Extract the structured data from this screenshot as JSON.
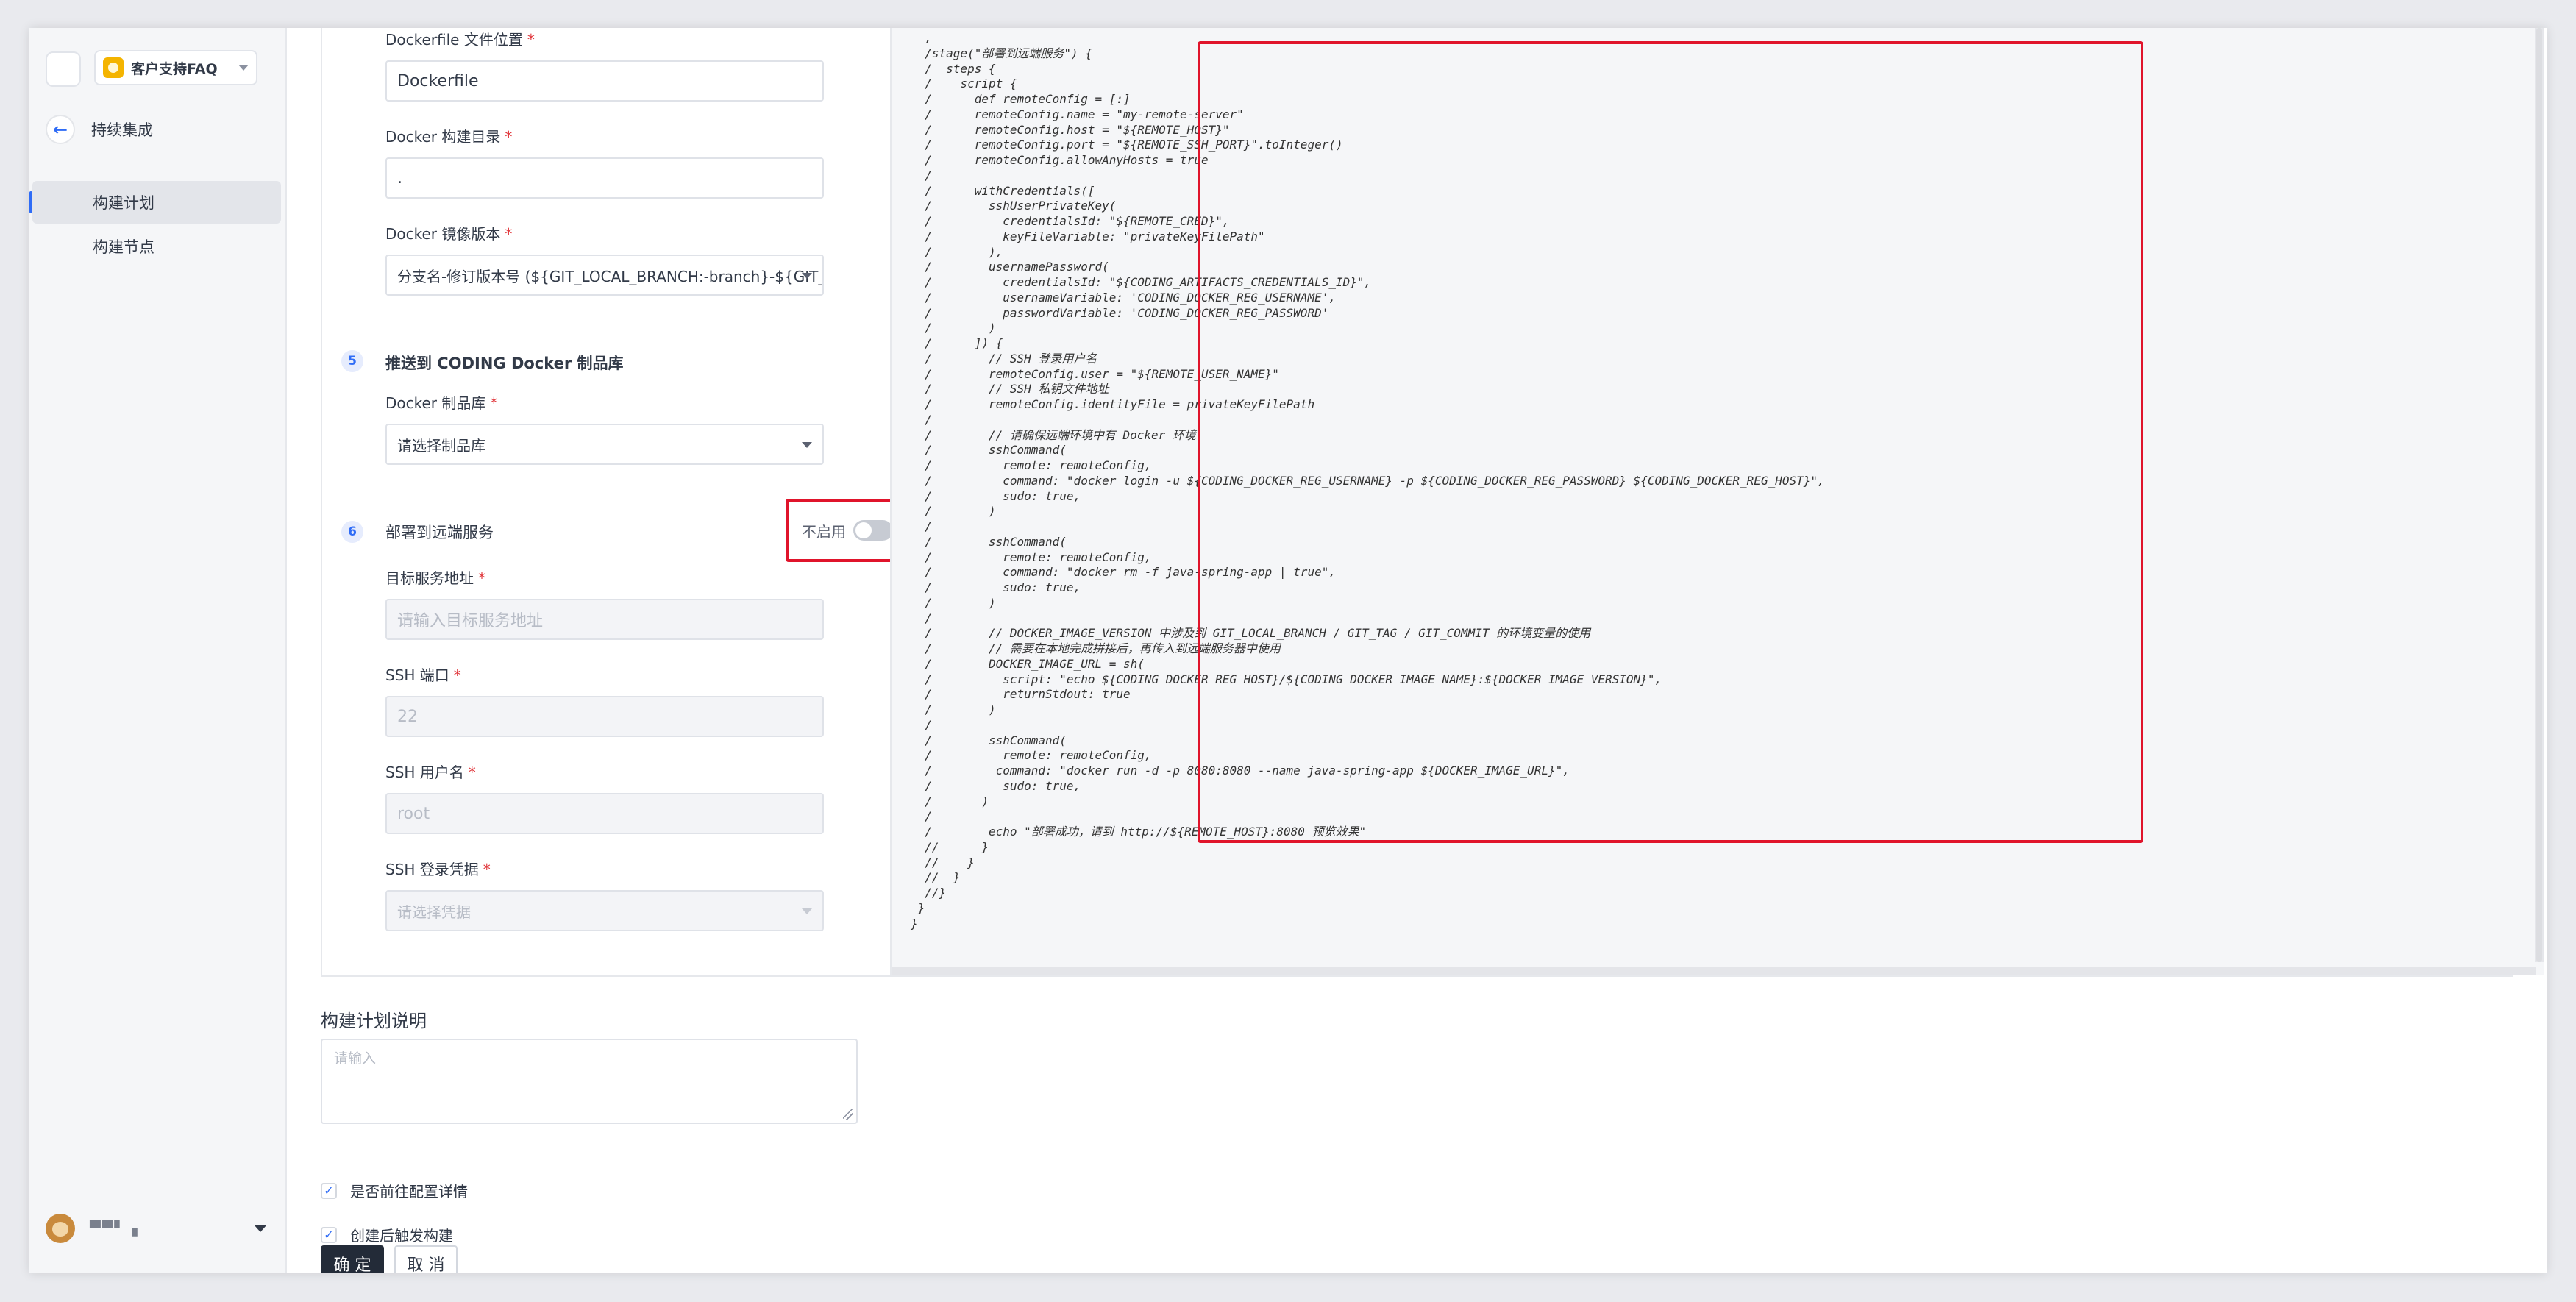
{
  "sidebar": {
    "project_name": "客户支持FAQ",
    "back_label": "持续集成",
    "items": [
      {
        "label": "构建计划",
        "active": true
      },
      {
        "label": "构建节点",
        "active": false
      }
    ],
    "user_name": "▀▀▘▗"
  },
  "form": {
    "dockerfile_label": "Dockerfile 文件位置",
    "dockerfile_value": "Dockerfile",
    "build_dir_label": "Docker 构建目录",
    "build_dir_value": ".",
    "image_version_label": "Docker 镜像版本",
    "image_version_value": "分支名-修订版本号 (${GIT_LOCAL_BRANCH:-branch}-${GIT_",
    "step5": {
      "number": "5",
      "title": "推送到 CODING Docker 制品库"
    },
    "registry_label": "Docker 制品库",
    "registry_placeholder": "请选择制品库",
    "step6": {
      "number": "6",
      "title": "部署到远端服务"
    },
    "toggle_label": "不启用",
    "toggle_on": false,
    "host_label": "目标服务地址",
    "host_placeholder": "请输入目标服务地址",
    "ssh_port_label": "SSH 端口",
    "ssh_port_value": "22",
    "ssh_user_label": "SSH 用户名",
    "ssh_user_value": "root",
    "ssh_cred_label": "SSH 登录凭据",
    "ssh_cred_placeholder": "请选择凭据",
    "required_mark": "*"
  },
  "code": {
    "text": "  ,\n  /stage(\"部署到远端服务\") {\n  /  steps {\n  /    script {\n  /      def remoteConfig = [:]\n  /      remoteConfig.name = \"my-remote-server\"\n  /      remoteConfig.host = \"${REMOTE_HOST}\"\n  /      remoteConfig.port = \"${REMOTE_SSH_PORT}\".toInteger()\n  /      remoteConfig.allowAnyHosts = true\n  /\n  /      withCredentials([\n  /        sshUserPrivateKey(\n  /          credentialsId: \"${REMOTE_CRED}\",\n  /          keyFileVariable: \"privateKeyFilePath\"\n  /        ),\n  /        usernamePassword(\n  /          credentialsId: \"${CODING_ARTIFACTS_CREDENTIALS_ID}\",\n  /          usernameVariable: 'CODING_DOCKER_REG_USERNAME',\n  /          passwordVariable: 'CODING_DOCKER_REG_PASSWORD'\n  /        )\n  /      ]) {\n  /        // SSH 登录用户名\n  /        remoteConfig.user = \"${REMOTE_USER_NAME}\"\n  /        // SSH 私钥文件地址\n  /        remoteConfig.identityFile = privateKeyFilePath\n  /\n  /        // 请确保远端环境中有 Docker 环境\n  /        sshCommand(\n  /          remote: remoteConfig,\n  /          command: \"docker login -u ${CODING_DOCKER_REG_USERNAME} -p ${CODING_DOCKER_REG_PASSWORD} ${CODING_DOCKER_REG_HOST}\",\n  /          sudo: true,\n  /        )\n  /\n  /        sshCommand(\n  /          remote: remoteConfig,\n  /          command: \"docker rm -f java-spring-app | true\",\n  /          sudo: true,\n  /        )\n  /\n  /        // DOCKER_IMAGE_VERSION 中涉及到 GIT_LOCAL_BRANCH / GIT_TAG / GIT_COMMIT 的环境变量的使用\n  /        // 需要在本地完成拼接后，再传入到远端服务器中使用\n  /        DOCKER_IMAGE_URL = sh(\n  /          script: \"echo ${CODING_DOCKER_REG_HOST}/${CODING_DOCKER_IMAGE_NAME}:${DOCKER_IMAGE_VERSION}\",\n  /          returnStdout: true\n  /        )\n  /\n  /        sshCommand(\n  /          remote: remoteConfig,\n  /         command: \"docker run -d -p 8080:8080 --name java-spring-app ${DOCKER_IMAGE_URL}\",\n  /          sudo: true,\n  /       )\n  /\n  /        echo \"部署成功，请到 http://${REMOTE_HOST}:8080 预览效果\"\n  //      }\n  //    }\n  //  }\n  //}\n }\n}"
  },
  "description": {
    "title": "构建计划说明",
    "placeholder": "请输入"
  },
  "options": [
    {
      "label": "是否前往配置详情",
      "checked": true
    },
    {
      "label": "创建后触发构建",
      "checked": true
    }
  ],
  "buttons": {
    "confirm": "确 定",
    "cancel": "取 消"
  },
  "colors": {
    "accent": "#2f6cf6",
    "highlight": "#e0142b",
    "primary_button": "#232b38"
  }
}
